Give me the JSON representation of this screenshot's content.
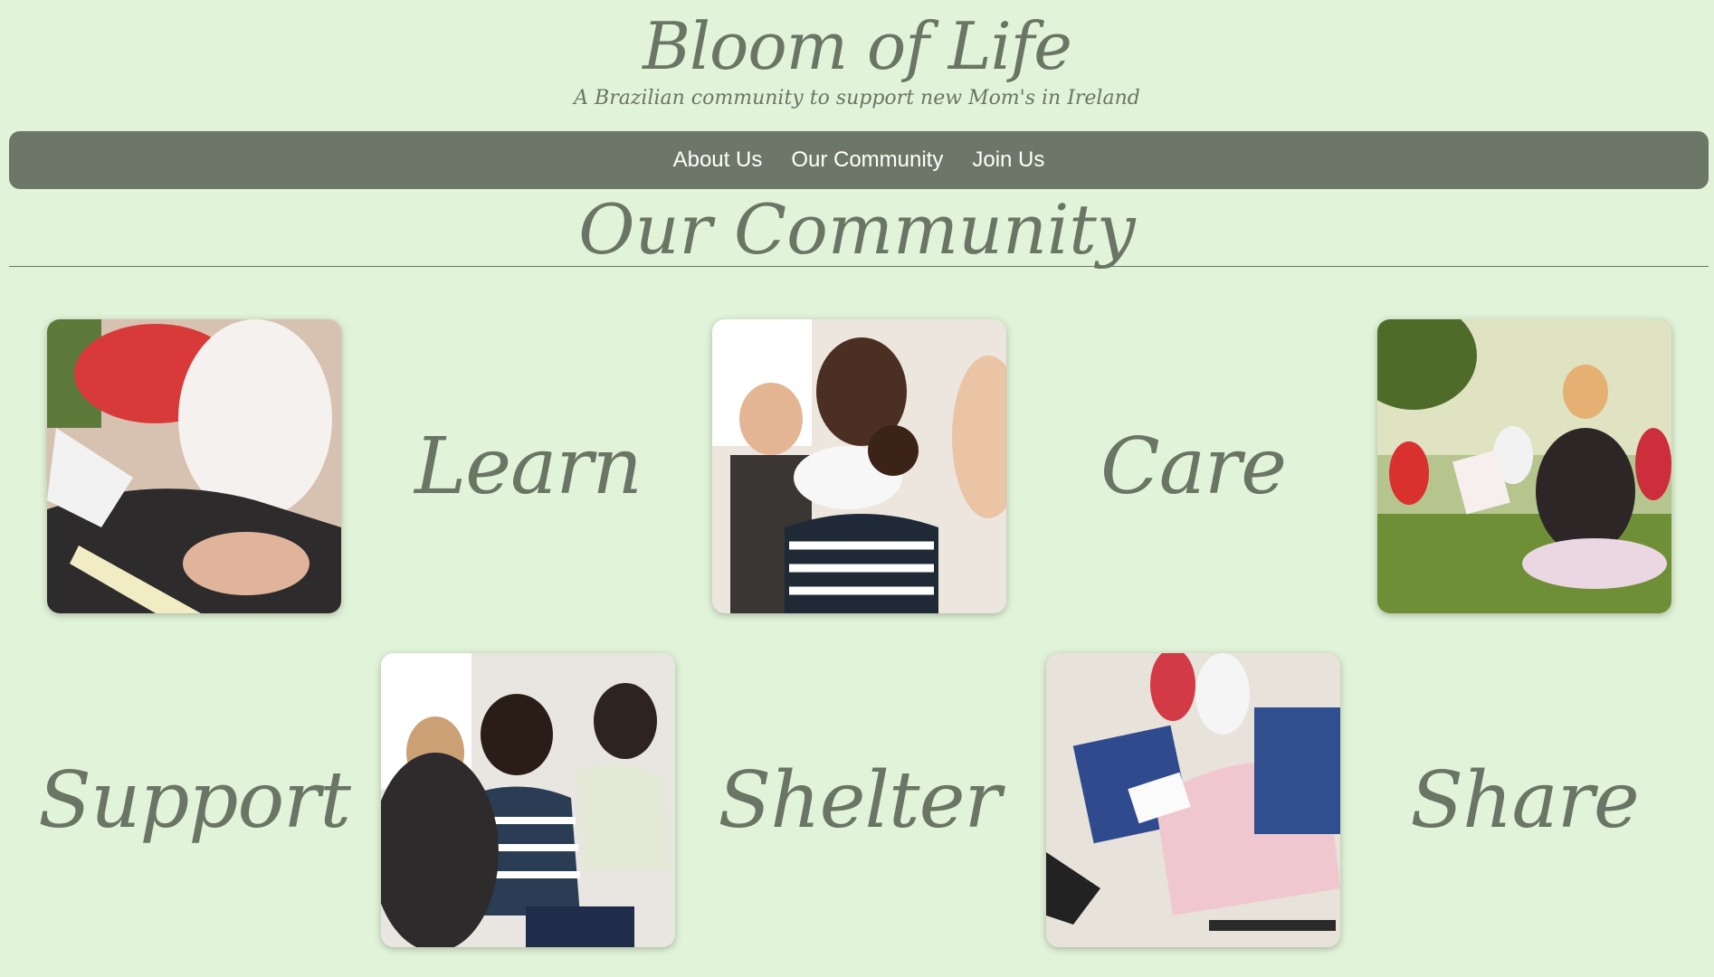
{
  "header": {
    "title": "Bloom of Life",
    "tagline": "A Brazilian community to support new Mom's in Ireland"
  },
  "nav": {
    "items": [
      {
        "label": "About Us"
      },
      {
        "label": "Our Community"
      },
      {
        "label": "Join Us"
      }
    ]
  },
  "section": {
    "title": "Our Community"
  },
  "grid": {
    "words": {
      "learn": "Learn",
      "care": "Care",
      "support": "Support",
      "shelter": "Shelter",
      "share": "Share"
    },
    "photos": [
      {
        "icon": "pregnant-women-reading-photo"
      },
      {
        "icon": "mother-holding-baby-photo"
      },
      {
        "icon": "outdoor-prenatal-class-photo"
      },
      {
        "icon": "support-group-photo"
      },
      {
        "icon": "seated-pregnant-women-photo"
      }
    ]
  },
  "colors": {
    "background": "#e1f3d8",
    "nav_background": "#6d7767",
    "text": "#6b7565",
    "nav_text": "#ffffff"
  }
}
